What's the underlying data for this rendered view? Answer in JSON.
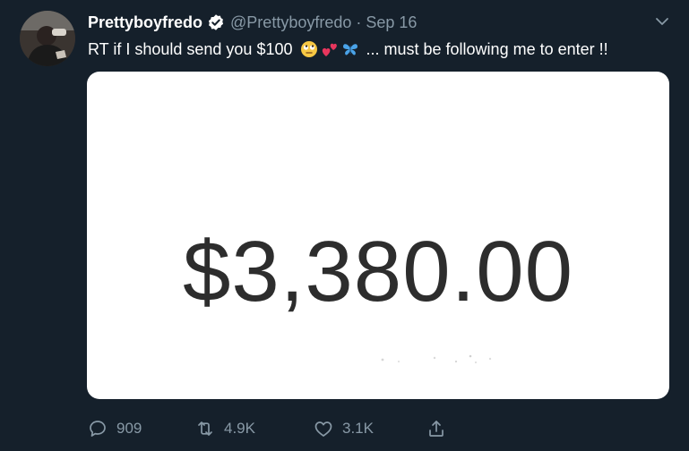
{
  "tweet": {
    "display_name": "Prettyboyfredo",
    "handle": "@Prettyboyfredo",
    "separator": "·",
    "date": "Sep 16",
    "text_before_emoji": "RT if I should send you $100",
    "text_after_emoji": "... must be following me to enter !!",
    "emojis": [
      "face-with-rolling-eyes-icon",
      "two-hearts-icon",
      "butterfly-icon"
    ],
    "media_amount": "$3,380.00"
  },
  "actions": {
    "reply_count": "909",
    "retweet_count": "4.9K",
    "like_count": "3.1K"
  },
  "colors": {
    "background": "#15202b",
    "secondary_text": "#8899a6",
    "verified_blue": "#1da1f2",
    "media_background": "#ffffff",
    "amount_text": "#2d2d2d"
  }
}
